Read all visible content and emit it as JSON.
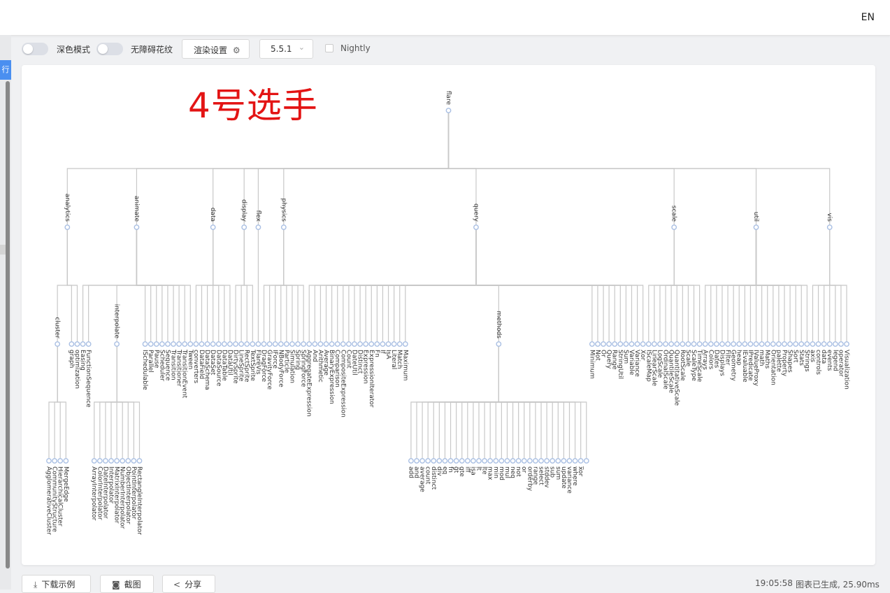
{
  "topbar": {
    "lang": "EN"
  },
  "left": {
    "tab_label": "行"
  },
  "toolbar": {
    "dark_label": "深色模式",
    "a11y_label": "无障碍花纹",
    "render_label": "渲染设置",
    "version_value": "5.5.1",
    "nightly_label": "Nightly"
  },
  "overlay_title": "4号选手",
  "colors": {
    "line": "#c8c8c8",
    "node_stroke": "#a9bfe3",
    "node_fill_leaf": "#b9c9e6",
    "title": "#e31414",
    "accent": "#4a8ff0"
  },
  "tree": {
    "name": "flare",
    "children": [
      {
        "name": "analytics",
        "children": [
          {
            "name": "cluster",
            "children": [
              "AgglomerativeCluster",
              "CommunityStructure",
              "HierarchicalCluster",
              "MergeEdge"
            ]
          },
          "graph",
          "optimization"
        ]
      },
      {
        "name": "animate",
        "children": [
          "Easing",
          "FunctionSequence",
          {
            "name": "interpolate",
            "children": [
              "ArrayInterpolator",
              "ColorInterpolator",
              "DateInterpolator",
              "Interpolator",
              "MatrixInterpolator",
              "NumberInterpolator",
              "ObjectInterpolator",
              "PointInterpolator",
              "RectangleInterpolator"
            ]
          },
          "ISchedulable",
          "Parallel",
          "Pause",
          "Scheduler",
          "Sequence",
          "Transition",
          "Transitioner",
          "TransitionEvent",
          "Tween"
        ]
      },
      {
        "name": "data",
        "children": [
          "converters",
          "DataField",
          "DataSchema",
          "DataSet",
          "DataSource",
          "DataTable",
          "DataUtil"
        ]
      },
      {
        "name": "display",
        "children": [
          "DirtySprite",
          "LineSprite",
          "RectSprite",
          "TextSprite"
        ]
      },
      {
        "name": "flex",
        "children": [
          "FlareVis"
        ]
      },
      {
        "name": "physics",
        "children": [
          "DragForce",
          "GravityForce",
          "IForce",
          "NBodyForce",
          "Particle",
          "Simulation",
          "Spring",
          "SpringForce"
        ]
      },
      {
        "name": "query",
        "children": [
          "AggregateExpression",
          "And",
          "Arithmetic",
          "Average",
          "BinaryExpression",
          "Comparison",
          "CompositeExpression",
          "Count",
          "DateUtil",
          "Distinct",
          "Expression",
          "ExpressionIterator",
          "Fn",
          "If",
          "IsA",
          "Literal",
          "Match",
          "Maximum",
          {
            "name": "methods",
            "children": [
              "add",
              "and",
              "average",
              "count",
              "distinct",
              "div",
              "eq",
              "fn",
              "gt",
              "gte",
              "iff",
              "isa",
              "lt",
              "lte",
              "max",
              "min",
              "mod",
              "mul",
              "neq",
              "not",
              "or",
              "orderby",
              "range",
              "select",
              "stddev",
              "sub",
              "sum",
              "update",
              "variance",
              "where",
              "xor",
              "_"
            ]
          },
          "Minimum",
          "Not",
          "Or",
          "Query",
          "Range",
          "StringUtil",
          "Sum",
          "Variable",
          "Variance",
          "Xor"
        ]
      },
      {
        "name": "scale",
        "children": [
          "IScaleMap",
          "LinearScale",
          "LogScale",
          "OrdinalScale",
          "QuantileScale",
          "QuantitativeScale",
          "RootScale",
          "Scale",
          "ScaleType",
          "TimeScale"
        ]
      },
      {
        "name": "util",
        "children": [
          "Arrays",
          "Colors",
          "Dates",
          "Displays",
          "Filter",
          "Geometry",
          "heap",
          "IEvaluable",
          "IPredicate",
          "IValueProxy",
          "math",
          "Maths",
          "Orientation",
          "palette",
          "Property",
          "Shapes",
          "Sort",
          "Stats",
          "Strings"
        ]
      },
      {
        "name": "vis",
        "children": [
          "axis",
          "controls",
          "data",
          "events",
          "legend",
          "operator",
          "Visualization"
        ]
      }
    ]
  },
  "bottom": {
    "download_label": "下载示例",
    "screenshot_label": "截图",
    "share_label": "分享",
    "time": "19:05:58",
    "status": "图表已生成, 25.90ms"
  }
}
